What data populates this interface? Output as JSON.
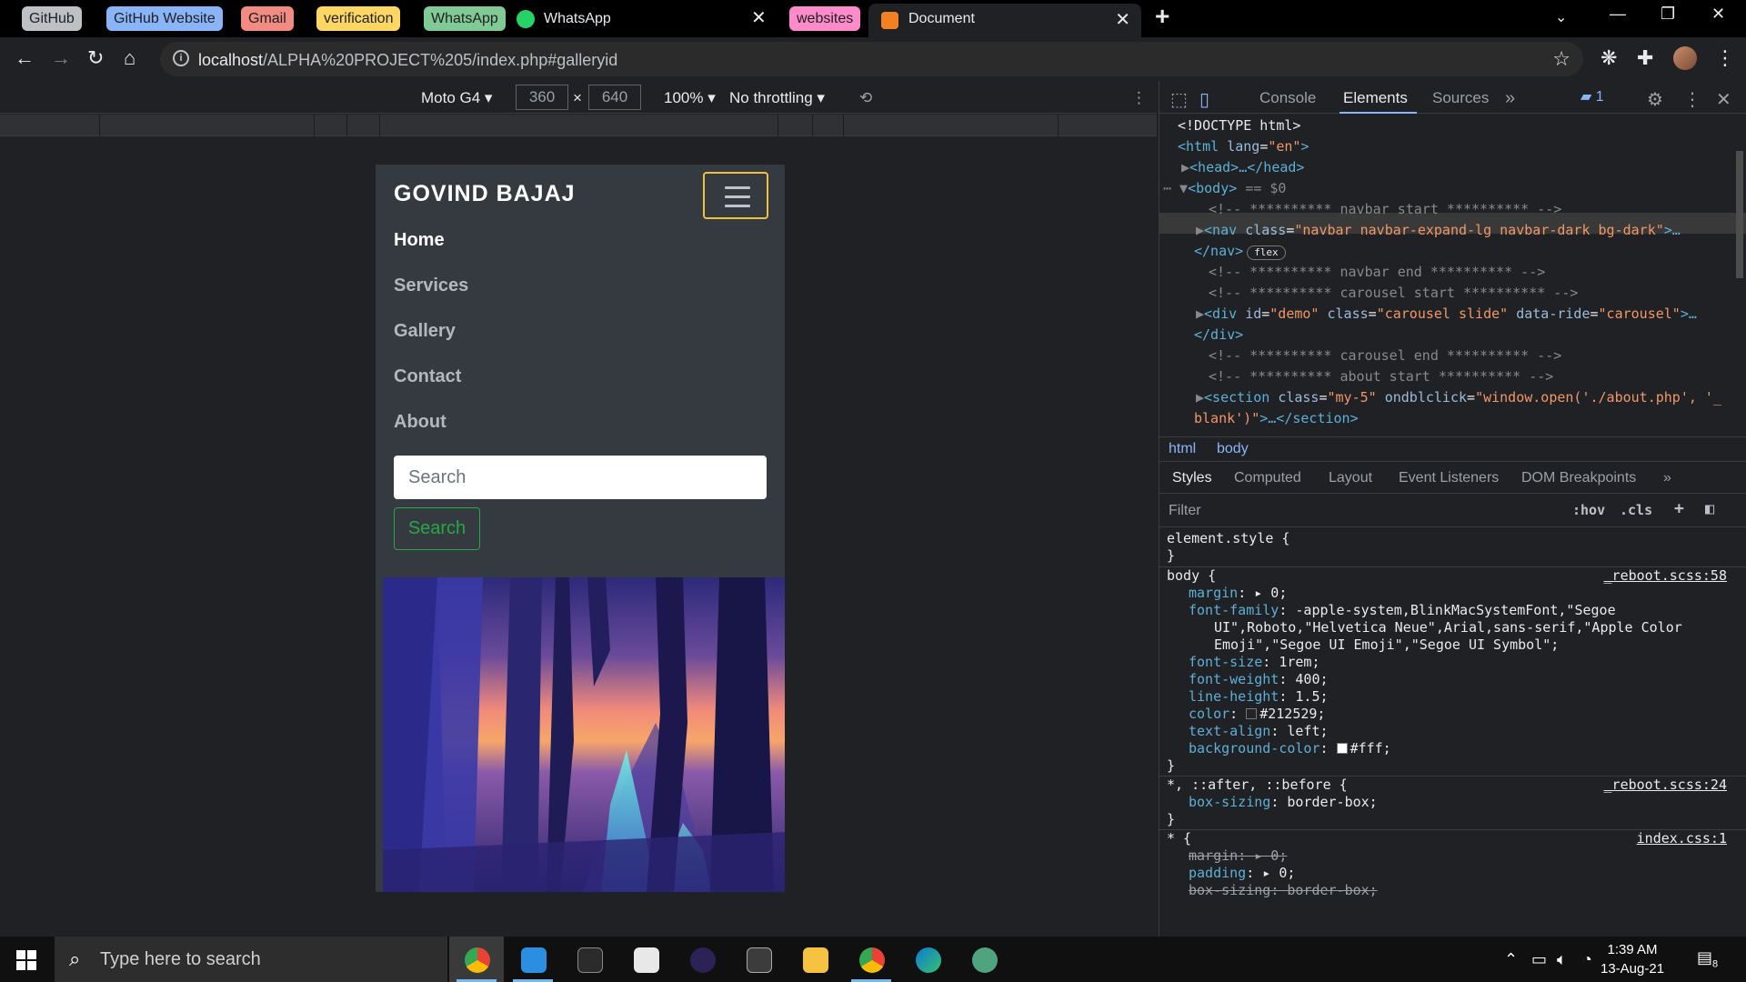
{
  "browser": {
    "tab_groups": [
      {
        "label": "GitHub",
        "color": "#bdc1c6"
      },
      {
        "label": "GitHub Website",
        "color": "#8ab4f8"
      },
      {
        "label": "Gmail",
        "color": "#f28b82"
      },
      {
        "label": "verification",
        "color": "#fdd663"
      },
      {
        "label": "WhatsApp",
        "color": "#81c995"
      },
      {
        "label": "websites",
        "color": "#ff8bcb"
      }
    ],
    "pinned_tab": {
      "title": "WhatsApp",
      "icon": "whatsapp-icon"
    },
    "active_tab": {
      "title": "Document",
      "icon": "xampp-icon"
    },
    "address": {
      "host": "localhost",
      "path": "/ALPHA%20PROJECT%205/index.php#galleryid"
    }
  },
  "device_toolbar": {
    "device": "Moto G4",
    "width": "360",
    "height": "640",
    "times": "×",
    "zoom": "100%",
    "throttling": "No throttling"
  },
  "site": {
    "brand": "GOVIND BAJAJ",
    "nav": [
      {
        "label": "Home",
        "active": true
      },
      {
        "label": "Services",
        "active": false
      },
      {
        "label": "Gallery",
        "active": false
      },
      {
        "label": "Contact",
        "active": false
      },
      {
        "label": "About",
        "active": false
      }
    ],
    "search_placeholder": "Search",
    "search_button": "Search"
  },
  "devtools": {
    "tabs": [
      "Console",
      "Elements",
      "Sources"
    ],
    "active_tab": "Elements",
    "issues_count": "1",
    "dom": {
      "doctype": "<!DOCTYPE html>",
      "html_open": "<html",
      "lang_attr": "lang",
      "lang_val": "\"en\"",
      "head": "<head>…</head>",
      "body_line": "<body>",
      "body_ref": "== $0",
      "c_navbar_start": "<!-- ********** navbar start ********** -->",
      "nav_tag": "<nav",
      "nav_class_attr": "class",
      "nav_class_val": "\"navbar navbar-expand-lg navbar-dark bg-dark\"",
      "nav_tail": ">…",
      "nav_close": "</nav>",
      "flex_badge": "flex",
      "c_navbar_end": "<!-- ********** navbar end ********** -->",
      "c_carousel_start": "<!-- ********** carousel start ********** -->",
      "div_tag": "<div",
      "div_id_attr": "id",
      "div_id_val": "\"demo\"",
      "div_class_attr": "class",
      "div_class_val": "\"carousel slide\"",
      "div_ride_attr": "data-ride",
      "div_ride_val": "\"carousel\"",
      "div_close": "</div>",
      "c_carousel_end": "<!-- ********** carousel end ********** -->",
      "c_about_start": "<!-- ********** about start ********** -->",
      "section_tag": "<section",
      "section_class_attr": "class",
      "section_class_val": "\"my-5\"",
      "section_dbl_attr": "ondblclick",
      "section_dbl_val": "\"window.open('./about.php', '_",
      "section_dbl_val2": "blank')\"",
      "section_close": ">…</section>"
    },
    "breadcrumbs": [
      "html",
      "body"
    ],
    "style_tabs": [
      "Styles",
      "Computed",
      "Layout",
      "Event Listeners",
      "DOM Breakpoints"
    ],
    "filter_placeholder": "Filter",
    "filter_tools": [
      ":hov",
      ".cls",
      "+"
    ],
    "styles": {
      "element_style": "element.style {",
      "close": "}",
      "body_selector": "body {",
      "body_source": "_reboot.scss:58",
      "body_props": [
        {
          "name": "margin",
          "value": "▸ 0;"
        },
        {
          "name": "font-family",
          "value": "-apple-system,BlinkMacSystemFont,\"Segoe"
        },
        {
          "name": "",
          "value": "UI\",Roboto,\"Helvetica Neue\",Arial,sans-serif,\"Apple Color"
        },
        {
          "name": "",
          "value": "Emoji\",\"Segoe UI Emoji\",\"Segoe UI Symbol\";"
        },
        {
          "name": "font-size",
          "value": "1rem;"
        },
        {
          "name": "font-weight",
          "value": "400;"
        },
        {
          "name": "line-height",
          "value": "1.5;"
        },
        {
          "name": "color",
          "value": "#212529;",
          "swatch": "#212529"
        },
        {
          "name": "text-align",
          "value": "left;"
        },
        {
          "name": "background-color",
          "value": "#fff;",
          "swatch": "#ffffff"
        }
      ],
      "universal_selector": "*, ::after, ::before {",
      "universal_source": "_reboot.scss:24",
      "universal_prop": {
        "name": "box-sizing",
        "value": "border-box;"
      },
      "star_selector": "* {",
      "star_source": "index.css:1",
      "star_props": [
        {
          "name": "margin",
          "value": "▸ 0;",
          "struck": true
        },
        {
          "name": "padding",
          "value": "▸ 0;",
          "struck": false
        },
        {
          "name": "box-sizing",
          "value": "border-box;",
          "struck": true
        }
      ]
    }
  },
  "taskbar": {
    "search_placeholder": "Type here to search",
    "time": "1:39 AM",
    "date": "13-Aug-21",
    "notifications": "8"
  }
}
